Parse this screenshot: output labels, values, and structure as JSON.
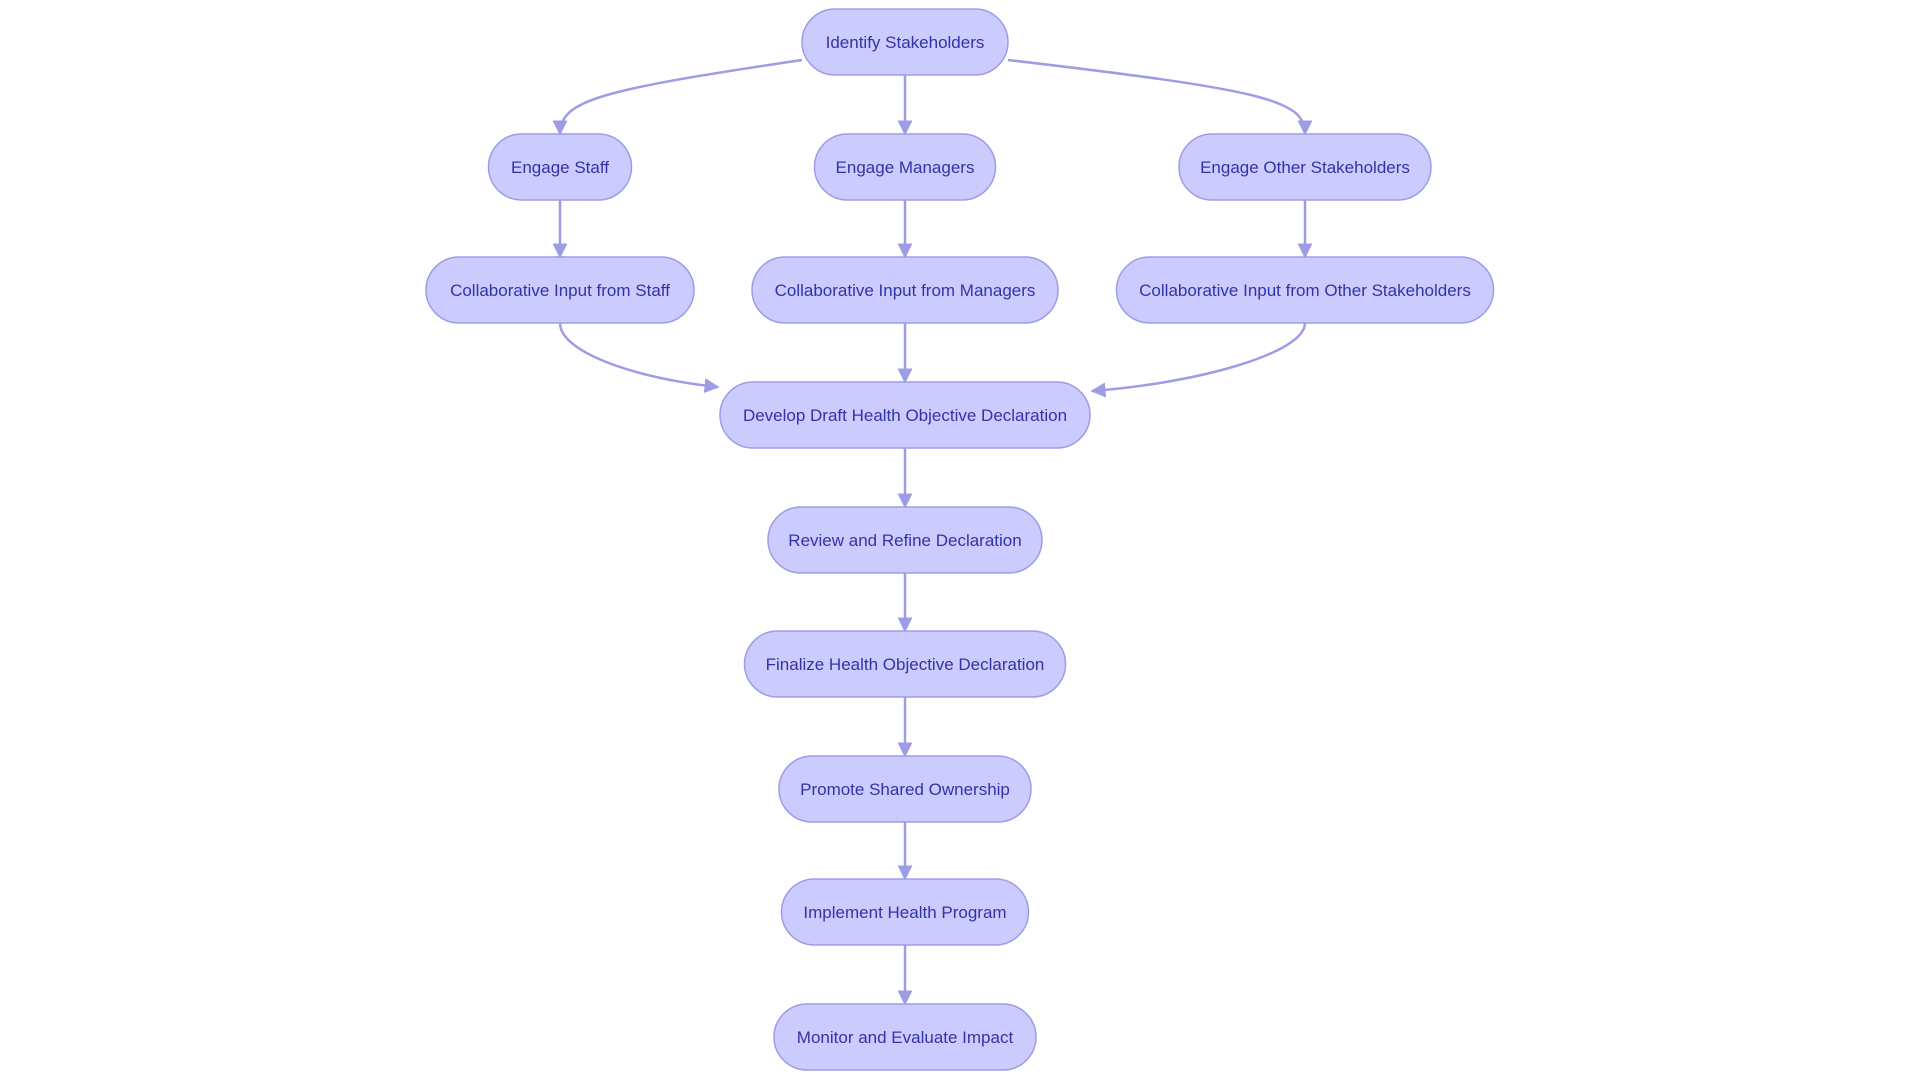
{
  "diagram": {
    "type": "flowchart",
    "direction": "top-down",
    "colors": {
      "node_fill": "#cbcbfe",
      "node_stroke": "#9d9de6",
      "text": "#3333a8",
      "edge": "#9d9de6"
    },
    "nodes": [
      {
        "id": "identify",
        "label": "Identify Stakeholders",
        "col": 1,
        "row": 0
      },
      {
        "id": "staff",
        "label": "Engage Staff",
        "col": 0,
        "row": 1
      },
      {
        "id": "managers",
        "label": "Engage Managers",
        "col": 1,
        "row": 1
      },
      {
        "id": "other",
        "label": "Engage Other Stakeholders",
        "col": 2,
        "row": 1
      },
      {
        "id": "in_staff",
        "label": "Collaborative Input from Staff",
        "col": 0,
        "row": 2
      },
      {
        "id": "in_managers",
        "label": "Collaborative Input from Managers",
        "col": 1,
        "row": 2
      },
      {
        "id": "in_other",
        "label": "Collaborative Input from Other Stakeholders",
        "col": 2,
        "row": 2
      },
      {
        "id": "draft",
        "label": "Develop Draft Health Objective Declaration",
        "col": 1,
        "row": 3
      },
      {
        "id": "review",
        "label": "Review and Refine Declaration",
        "col": 1,
        "row": 4
      },
      {
        "id": "finalize",
        "label": "Finalize Health Objective Declaration",
        "col": 1,
        "row": 5
      },
      {
        "id": "promote",
        "label": "Promote Shared Ownership",
        "col": 1,
        "row": 6
      },
      {
        "id": "implement",
        "label": "Implement Health Program",
        "col": 1,
        "row": 7
      },
      {
        "id": "monitor",
        "label": "Monitor and Evaluate Impact",
        "col": 1,
        "row": 8
      }
    ],
    "edges": [
      {
        "from": "identify",
        "to": "staff"
      },
      {
        "from": "identify",
        "to": "managers"
      },
      {
        "from": "identify",
        "to": "other"
      },
      {
        "from": "staff",
        "to": "in_staff"
      },
      {
        "from": "managers",
        "to": "in_managers"
      },
      {
        "from": "other",
        "to": "in_other"
      },
      {
        "from": "in_staff",
        "to": "draft"
      },
      {
        "from": "in_managers",
        "to": "draft"
      },
      {
        "from": "in_other",
        "to": "draft"
      },
      {
        "from": "draft",
        "to": "review"
      },
      {
        "from": "review",
        "to": "finalize"
      },
      {
        "from": "finalize",
        "to": "promote"
      },
      {
        "from": "promote",
        "to": "implement"
      },
      {
        "from": "implement",
        "to": "monitor"
      }
    ]
  }
}
